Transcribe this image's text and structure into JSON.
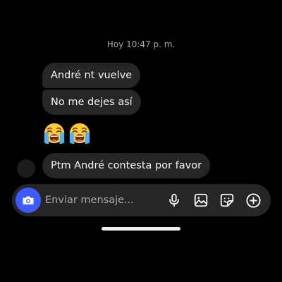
{
  "conversation": {
    "timestamp": "Hoy 10:47 p. m.",
    "messages": [
      {
        "text": "André nt vuelve"
      },
      {
        "text": "No me dejes así"
      },
      {
        "text": "Ptm André contesta por favor"
      }
    ],
    "emoji_message": {
      "emojis": [
        "loudly-crying-face",
        "loudly-crying-face"
      ]
    }
  },
  "composer": {
    "placeholder": "Enviar mensaje...",
    "value": "",
    "camera_icon": "camera-icon",
    "tools": [
      "microphone-icon",
      "gallery-icon",
      "sticker-icon",
      "add-icon"
    ]
  },
  "colors": {
    "background": "#000000",
    "bubble": "#262626",
    "composer": "#262626",
    "camera_accent": "#3d5afe",
    "text": "#f5f5f5",
    "muted_text": "#a8a8a8"
  }
}
